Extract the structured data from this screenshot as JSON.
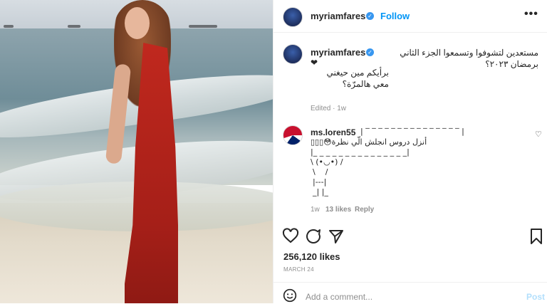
{
  "header": {
    "username": "myriamfares",
    "follow_label": "Follow",
    "more_label": "•••"
  },
  "caption": {
    "username": "myriamfares",
    "line1": "مستعدين لتشوفوا وتسمعوا الجزء الثاني    برمضان ٢٠٢٣؟",
    "heart": "❤",
    "line2": "برأيكم مين حيغني معي هالمرّة؟",
    "meta": "Edited · 1w"
  },
  "comment": {
    "username": "ms.loren55",
    "line1": "| ‾ ‾ ‾ ‾ ‾ ‾ ‾ ‾ ‾ ‾ ‾ ‾ ‾ ‾ ‾ |",
    "line2": "أنزل دروس انجلش الّي نظرة😳▯▯▯",
    "line3": "|_ _ _ _ _ _ _ _ _ _ _ _ _ _ _|",
    "line4": "\\ (•◡•) /",
    "line5": "\\    /",
    "line6": "|---|",
    "line7": "_| |_",
    "time": "1w",
    "likes": "13 likes",
    "reply": "Reply"
  },
  "actions": {
    "like_icon": "heart-icon",
    "comment_icon": "comment-icon",
    "share_icon": "share-icon",
    "save_icon": "bookmark-icon"
  },
  "likes": "256,120 likes",
  "date": "MARCH 24",
  "add_comment": {
    "placeholder": "Add a comment...",
    "post_label": "Post"
  }
}
